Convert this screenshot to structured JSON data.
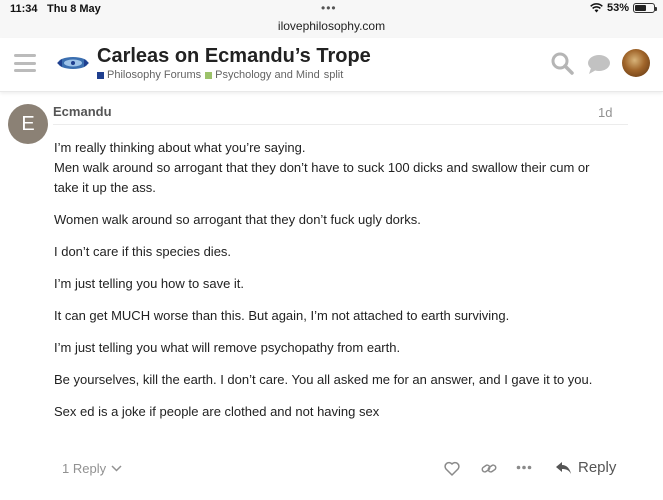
{
  "status_bar": {
    "time": "11:34",
    "date": "Thu 8 May",
    "battery": "53%",
    "battery_level": 0.53
  },
  "browser": {
    "url": "ilovephilosophy.com"
  },
  "topic": {
    "title": "Carleas on Ecmandu’s Trope",
    "categories": [
      {
        "label": "Philosophy Forums",
        "color": "#1f3f8f"
      },
      {
        "label": "Psychology and Mind",
        "color": "#9cc26a"
      }
    ],
    "tag": "split"
  },
  "post": {
    "avatar_letter": "E",
    "avatar_color": "#8b8175",
    "author": "Ecmandu",
    "age": "1d",
    "paragraphs": [
      "I’m really thinking about what you’re saying.",
      "Men walk around so arrogant that they don’t have to suck 100 dicks and swallow their cum or take it up the ass.",
      "Women walk around so arrogant that they don’t fuck ugly dorks.",
      "I don’t care if this species dies.",
      "I’m just telling you how to save it.",
      "It can get MUCH worse than this. But again, I’m not attached to earth surviving.",
      "I’m just telling you what will remove psychopathy from earth.",
      "Be yourselves, kill the earth. I don’t care. You all asked me for an answer, and I gave it to you.",
      "Sex ed is a joke if people are clothed and not having sex"
    ],
    "replies_label": "1 Reply",
    "reply_label": "Reply"
  },
  "icons": {
    "menu": "hamburger-icon",
    "search": "search-icon",
    "chat": "chat-icon",
    "like": "heart-icon",
    "link": "link-icon",
    "more": "ellipsis-icon",
    "reply": "reply-arrow-icon"
  }
}
